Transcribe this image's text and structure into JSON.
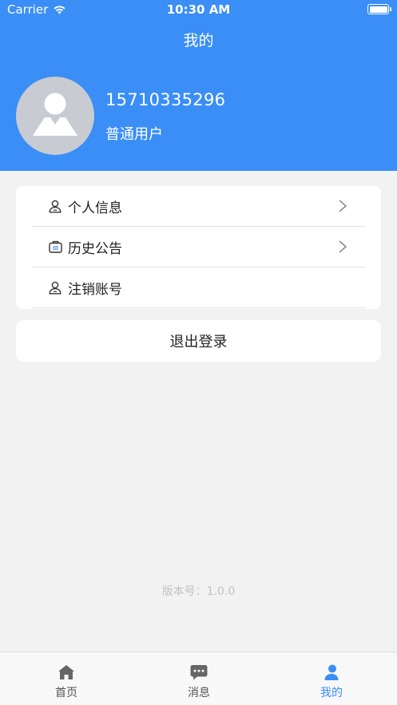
{
  "status_bar": {
    "carrier": "Carrier",
    "time": "10:30 AM"
  },
  "header": {
    "title": "我的"
  },
  "profile": {
    "phone": "15710335296",
    "role": "普通用户"
  },
  "menu": {
    "items": [
      {
        "label": "个人信息",
        "icon": "user-icon",
        "has_arrow": true
      },
      {
        "label": "历史公告",
        "icon": "briefcase-icon",
        "has_arrow": true
      },
      {
        "label": "注销账号",
        "icon": "user-icon",
        "has_arrow": false
      }
    ]
  },
  "logout": {
    "label": "退出登录"
  },
  "version": {
    "text": "版本号：1.0.0"
  },
  "tabbar": {
    "items": [
      {
        "label": "首页",
        "icon": "home-icon",
        "active": false
      },
      {
        "label": "消息",
        "icon": "message-icon",
        "active": false
      },
      {
        "label": "我的",
        "icon": "profile-icon",
        "active": true
      }
    ]
  },
  "colors": {
    "primary": "#3a8ef6",
    "background": "#f2f2f2",
    "inactive_tab": "#555555",
    "avatar_bg": "#c8cbd1"
  }
}
